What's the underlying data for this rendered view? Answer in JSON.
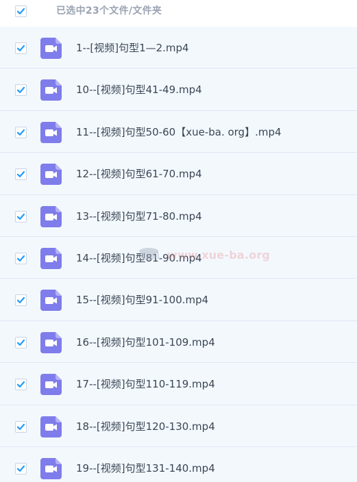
{
  "header": {
    "label": "已选中23个文件/文件夹",
    "select_all_checked": true
  },
  "colors": {
    "accent": "#1E9BFF",
    "icon_purple": "#7F7CEB",
    "row_background": "#F3F8FD",
    "row_border": "#DDE7F2",
    "header_text": "#9AA3B2",
    "file_text": "#3B4654"
  },
  "icons": {
    "checkbox": "check-icon",
    "file": "video-file-icon"
  },
  "files": [
    {
      "name": "1--[视频]句型1—2.mp4",
      "checked": true
    },
    {
      "name": "10--[视频]句型41-49.mp4",
      "checked": true
    },
    {
      "name": "11--[视频]句型50-60【xue-ba. org】.mp4",
      "checked": true
    },
    {
      "name": "12--[视频]句型61-70.mp4",
      "checked": true
    },
    {
      "name": "13--[视频]句型71-80.mp4",
      "checked": true
    },
    {
      "name": "14--[视频]句型81-90.mp4",
      "checked": true
    },
    {
      "name": "15--[视频]句型91-100.mp4",
      "checked": true
    },
    {
      "name": "16--[视频]句型101-109.mp4",
      "checked": true
    },
    {
      "name": "17--[视频]句型110-119.mp4",
      "checked": true
    },
    {
      "name": "18--[视频]句型120-130.mp4",
      "checked": true
    },
    {
      "name": "19--[视频]句型131-140.mp4",
      "checked": true
    }
  ],
  "watermark": {
    "text": "www.xue-ba.org"
  }
}
